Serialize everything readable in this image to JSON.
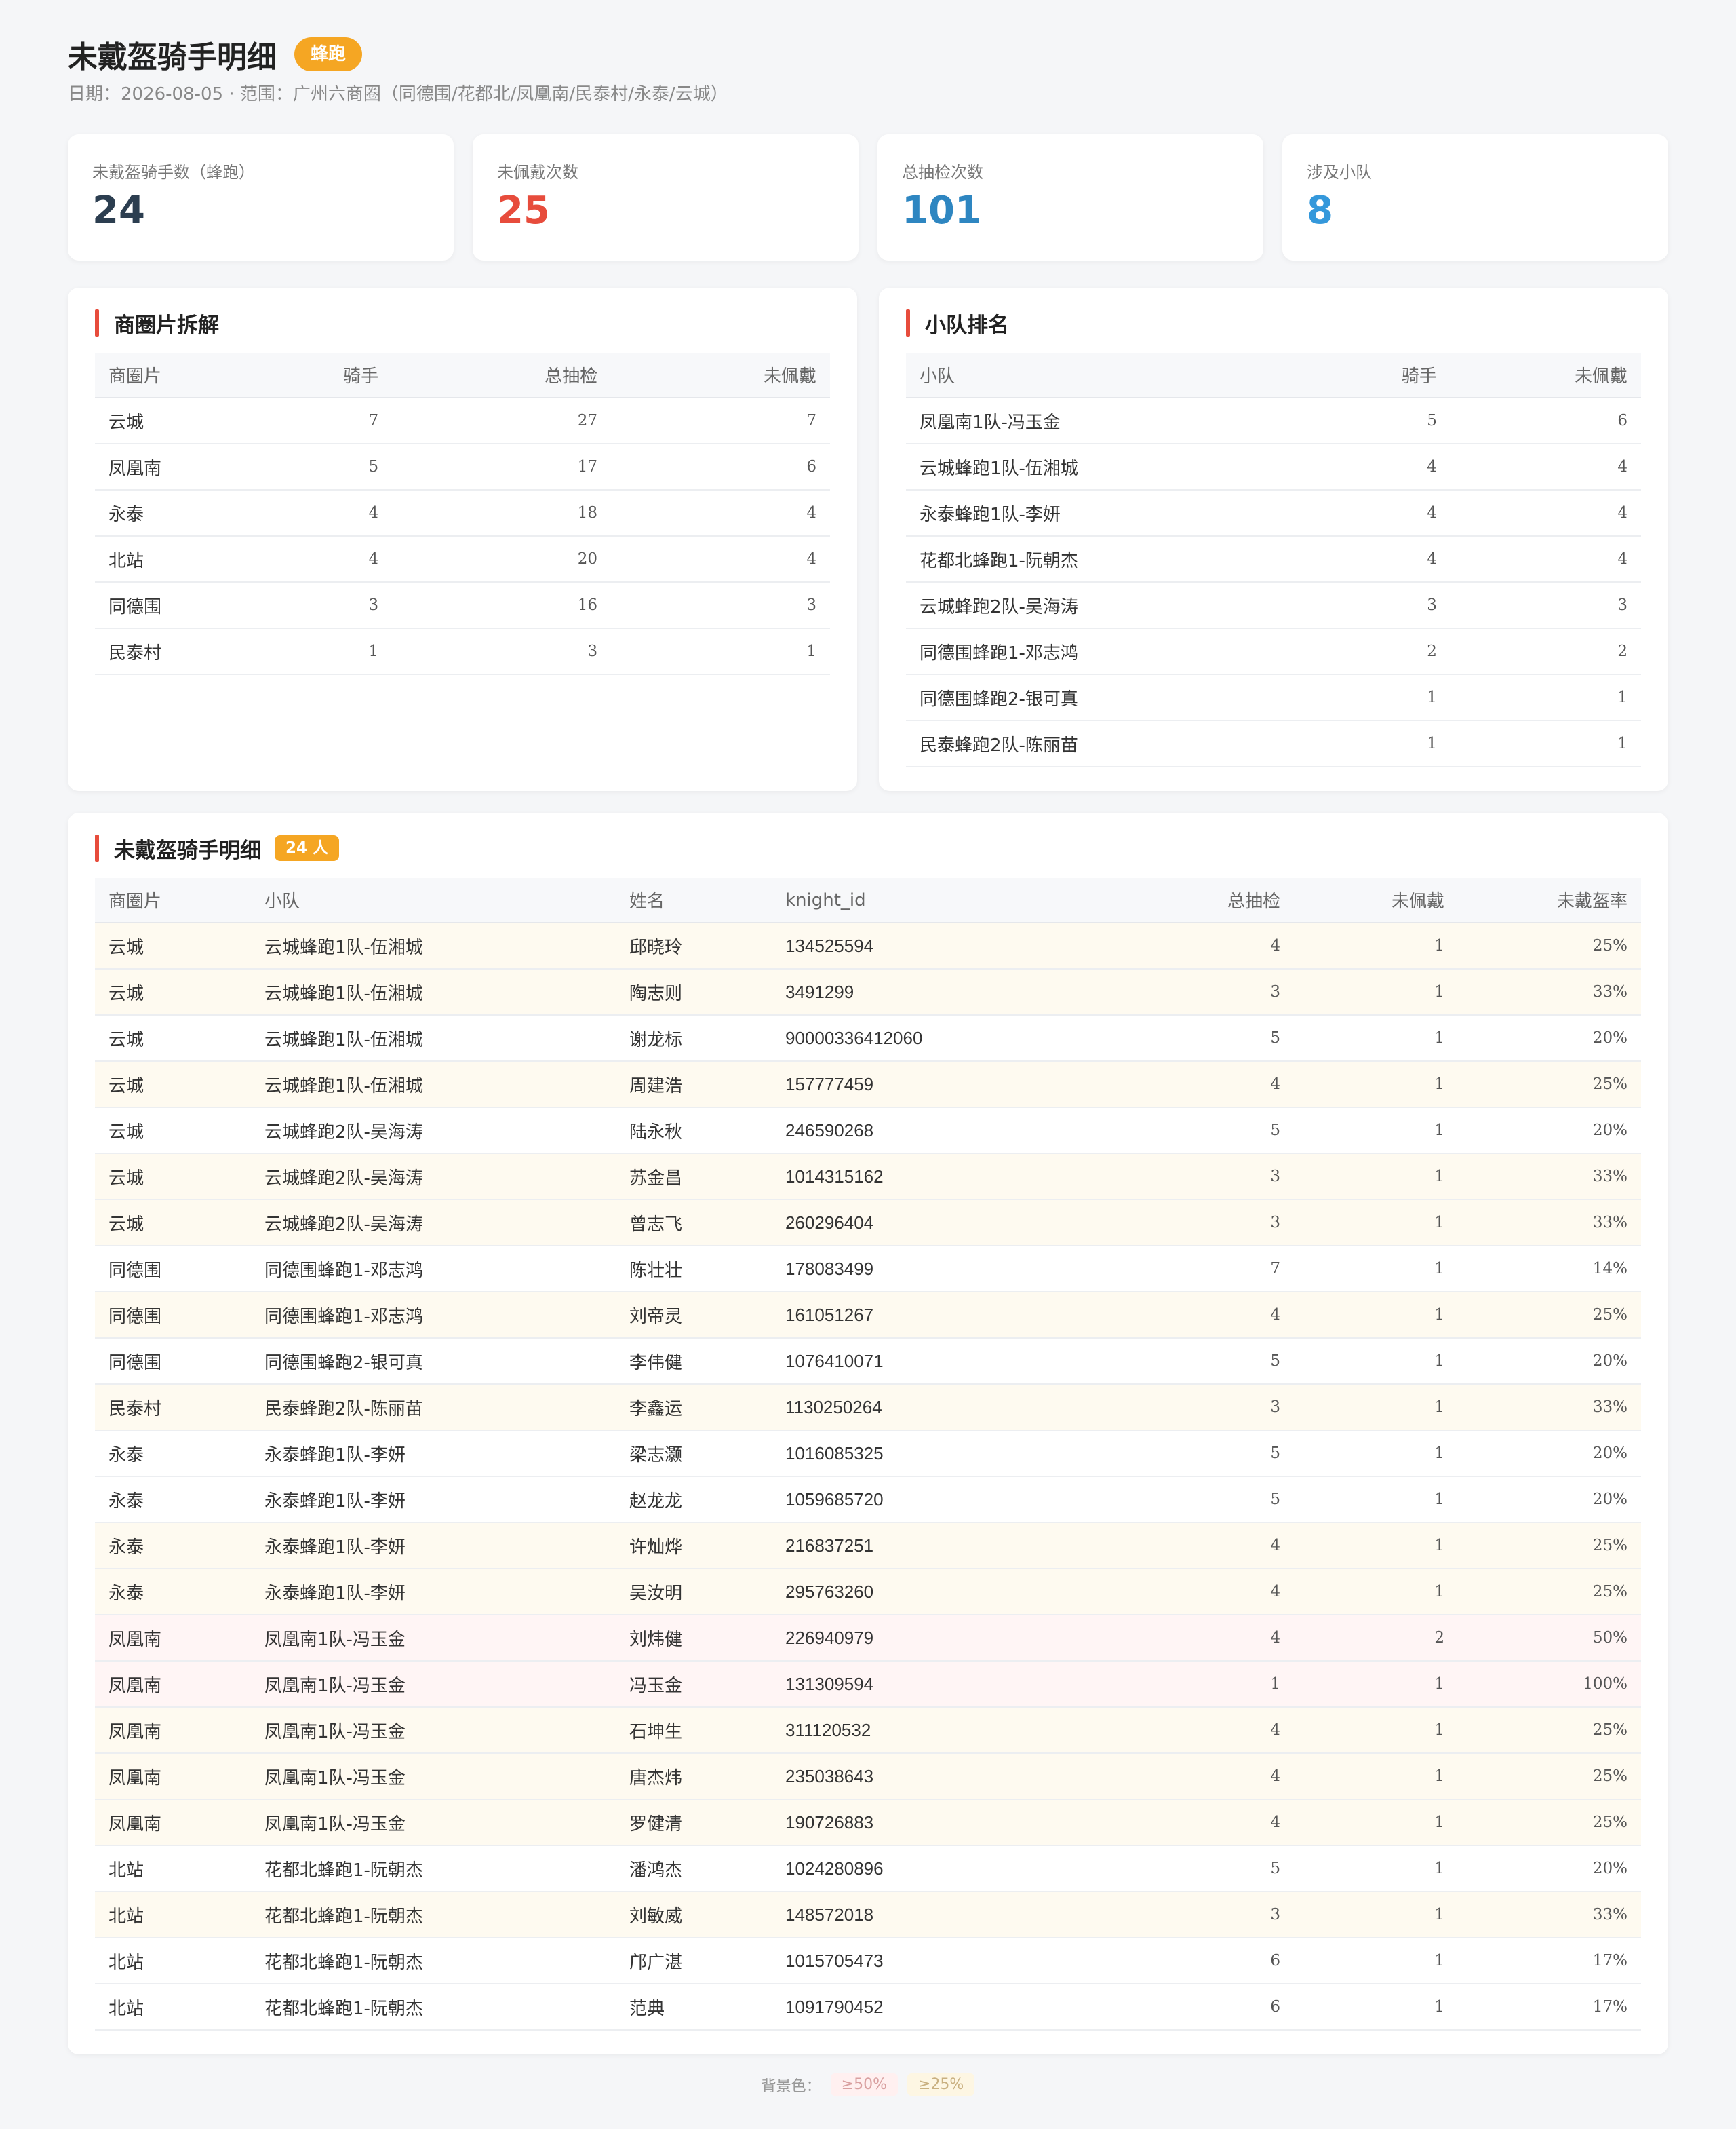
{
  "header": {
    "title": "未戴盔骑手明细",
    "badge": "蜂跑",
    "subtitle": "日期：2026-08-05 · 范围：广州六商圈（同德围/花都北/凤凰南/民泰村/永泰/云城）"
  },
  "stats": [
    {
      "label": "未戴盔骑手数（蜂跑）",
      "value": "24",
      "color": "#2c3e50"
    },
    {
      "label": "未佩戴次数",
      "value": "25",
      "color": "#e74c3c"
    },
    {
      "label": "总抽检次数",
      "value": "101",
      "color": "#2e86c1"
    },
    {
      "label": "涉及小队",
      "value": "8",
      "color": "#3498db"
    }
  ],
  "area_panel": {
    "title": "商圈片拆解",
    "headers": [
      "商圈片",
      "骑手",
      "总抽检",
      "未佩戴"
    ],
    "rows": [
      [
        "云城",
        "7",
        "27",
        "7"
      ],
      [
        "凤凰南",
        "5",
        "17",
        "6"
      ],
      [
        "永泰",
        "4",
        "18",
        "4"
      ],
      [
        "北站",
        "4",
        "20",
        "4"
      ],
      [
        "同德围",
        "3",
        "16",
        "3"
      ],
      [
        "民泰村",
        "1",
        "3",
        "1"
      ]
    ]
  },
  "team_panel": {
    "title": "小队排名",
    "headers": [
      "小队",
      "骑手",
      "未佩戴"
    ],
    "rows": [
      [
        "凤凰南1队-冯玉金",
        "5",
        "6"
      ],
      [
        "云城蜂跑1队-伍湘城",
        "4",
        "4"
      ],
      [
        "永泰蜂跑1队-李妍",
        "4",
        "4"
      ],
      [
        "花都北蜂跑1-阮朝杰",
        "4",
        "4"
      ],
      [
        "云城蜂跑2队-吴海涛",
        "3",
        "3"
      ],
      [
        "同德围蜂跑1-邓志鸿",
        "2",
        "2"
      ],
      [
        "同德围蜂跑2-银可真",
        "1",
        "1"
      ],
      [
        "民泰蜂跑2队-陈丽苗",
        "1",
        "1"
      ]
    ]
  },
  "detail": {
    "title": "未戴盔骑手明细",
    "count_badge": "24 人",
    "headers": [
      "商圈片",
      "小队",
      "姓名",
      "knight_id",
      "总抽检",
      "未佩戴",
      "未戴盔率"
    ],
    "rows": [
      {
        "level": "25",
        "cells": [
          "云城",
          "云城蜂跑1队-伍湘城",
          "邱晓玲",
          "134525594",
          "4",
          "1",
          "25%"
        ]
      },
      {
        "level": "25",
        "cells": [
          "云城",
          "云城蜂跑1队-伍湘城",
          "陶志则",
          "3491299",
          "3",
          "1",
          "33%"
        ]
      },
      {
        "level": "0",
        "cells": [
          "云城",
          "云城蜂跑1队-伍湘城",
          "谢龙标",
          "90000336412060",
          "5",
          "1",
          "20%"
        ]
      },
      {
        "level": "25",
        "cells": [
          "云城",
          "云城蜂跑1队-伍湘城",
          "周建浩",
          "157777459",
          "4",
          "1",
          "25%"
        ]
      },
      {
        "level": "0",
        "cells": [
          "云城",
          "云城蜂跑2队-吴海涛",
          "陆永秋",
          "246590268",
          "5",
          "1",
          "20%"
        ]
      },
      {
        "level": "25",
        "cells": [
          "云城",
          "云城蜂跑2队-吴海涛",
          "苏金昌",
          "1014315162",
          "3",
          "1",
          "33%"
        ]
      },
      {
        "level": "25",
        "cells": [
          "云城",
          "云城蜂跑2队-吴海涛",
          "曾志飞",
          "260296404",
          "3",
          "1",
          "33%"
        ]
      },
      {
        "level": "0",
        "cells": [
          "同德围",
          "同德围蜂跑1-邓志鸿",
          "陈壮壮",
          "178083499",
          "7",
          "1",
          "14%"
        ]
      },
      {
        "level": "25",
        "cells": [
          "同德围",
          "同德围蜂跑1-邓志鸿",
          "刘帝灵",
          "161051267",
          "4",
          "1",
          "25%"
        ]
      },
      {
        "level": "0",
        "cells": [
          "同德围",
          "同德围蜂跑2-银可真",
          "李伟健",
          "1076410071",
          "5",
          "1",
          "20%"
        ]
      },
      {
        "level": "25",
        "cells": [
          "民泰村",
          "民泰蜂跑2队-陈丽苗",
          "李鑫运",
          "1130250264",
          "3",
          "1",
          "33%"
        ]
      },
      {
        "level": "0",
        "cells": [
          "永泰",
          "永泰蜂跑1队-李妍",
          "梁志灏",
          "1016085325",
          "5",
          "1",
          "20%"
        ]
      },
      {
        "level": "0",
        "cells": [
          "永泰",
          "永泰蜂跑1队-李妍",
          "赵龙龙",
          "1059685720",
          "5",
          "1",
          "20%"
        ]
      },
      {
        "level": "25",
        "cells": [
          "永泰",
          "永泰蜂跑1队-李妍",
          "许灿烨",
          "216837251",
          "4",
          "1",
          "25%"
        ]
      },
      {
        "level": "25",
        "cells": [
          "永泰",
          "永泰蜂跑1队-李妍",
          "吴汝明",
          "295763260",
          "4",
          "1",
          "25%"
        ]
      },
      {
        "level": "50",
        "cells": [
          "凤凰南",
          "凤凰南1队-冯玉金",
          "刘炜健",
          "226940979",
          "4",
          "2",
          "50%"
        ]
      },
      {
        "level": "50",
        "cells": [
          "凤凰南",
          "凤凰南1队-冯玉金",
          "冯玉金",
          "131309594",
          "1",
          "1",
          "100%"
        ]
      },
      {
        "level": "25",
        "cells": [
          "凤凰南",
          "凤凰南1队-冯玉金",
          "石坤生",
          "311120532",
          "4",
          "1",
          "25%"
        ]
      },
      {
        "level": "25",
        "cells": [
          "凤凰南",
          "凤凰南1队-冯玉金",
          "唐杰炜",
          "235038643",
          "4",
          "1",
          "25%"
        ]
      },
      {
        "level": "25",
        "cells": [
          "凤凰南",
          "凤凰南1队-冯玉金",
          "罗健清",
          "190726883",
          "4",
          "1",
          "25%"
        ]
      },
      {
        "level": "0",
        "cells": [
          "北站",
          "花都北蜂跑1-阮朝杰",
          "潘鸿杰",
          "1024280896",
          "5",
          "1",
          "20%"
        ]
      },
      {
        "level": "25",
        "cells": [
          "北站",
          "花都北蜂跑1-阮朝杰",
          "刘敏威",
          "148572018",
          "3",
          "1",
          "33%"
        ]
      },
      {
        "level": "0",
        "cells": [
          "北站",
          "花都北蜂跑1-阮朝杰",
          "邝广湛",
          "1015705473",
          "6",
          "1",
          "17%"
        ]
      },
      {
        "level": "0",
        "cells": [
          "北站",
          "花都北蜂跑1-阮朝杰",
          "范典",
          "1091790452",
          "6",
          "1",
          "17%"
        ]
      }
    ]
  },
  "legend": {
    "label": "背景色：",
    "items": [
      "≥50%",
      "≥25%"
    ]
  }
}
